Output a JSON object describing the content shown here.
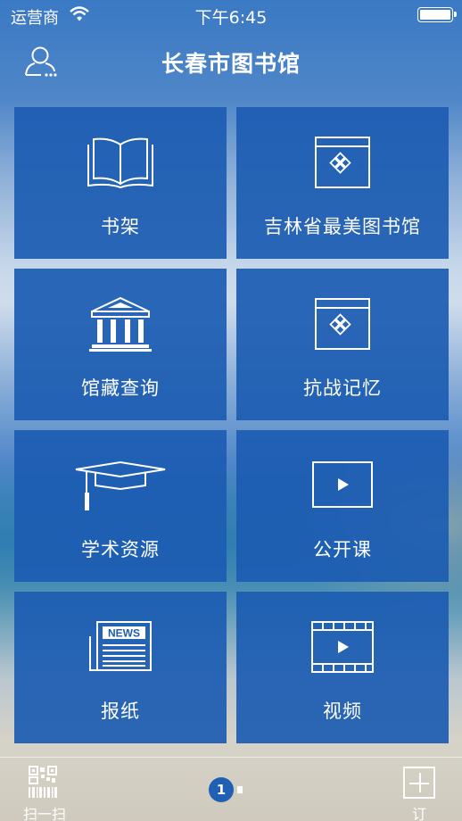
{
  "status_bar": {
    "carrier": "运营商",
    "time": "下午6:45"
  },
  "header": {
    "title": "长春市图书馆",
    "user_icon": "user-icon"
  },
  "tiles": [
    {
      "label": "书架",
      "icon": "open-book-icon"
    },
    {
      "label": "吉林省最美图书馆",
      "icon": "window-diamond-icon"
    },
    {
      "label": "馆藏查询",
      "icon": "library-building-icon"
    },
    {
      "label": "抗战记忆",
      "icon": "window-diamond-icon"
    },
    {
      "label": "学术资源",
      "icon": "graduation-cap-icon"
    },
    {
      "label": "公开课",
      "icon": "play-screen-icon"
    },
    {
      "label": "报纸",
      "icon": "newspaper-icon"
    },
    {
      "label": "视频",
      "icon": "film-play-icon"
    }
  ],
  "newspaper_icon_text": "NEWS",
  "tab_bar": {
    "scan_label": "扫一扫",
    "page_number": "1",
    "subscribe_label": "订阅"
  },
  "colors": {
    "tile": "#1c5cb2",
    "page_dot": "#2060b4"
  }
}
